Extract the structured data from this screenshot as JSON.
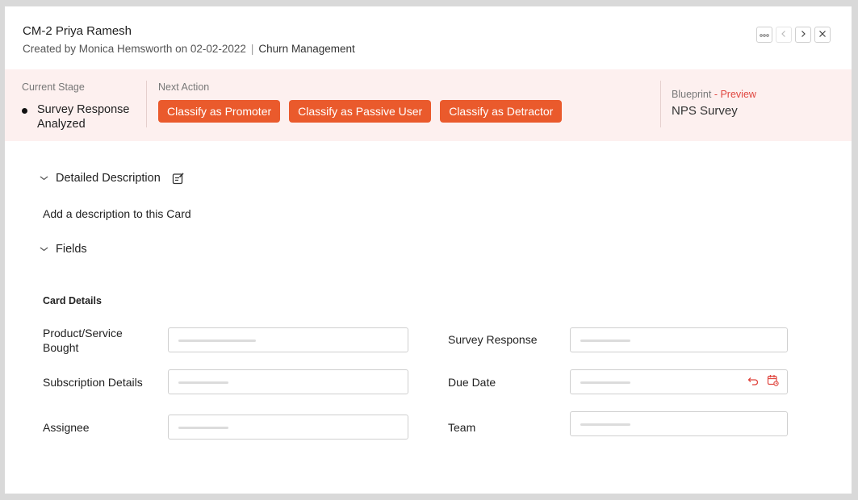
{
  "header": {
    "title": "CM-2 Priya Ramesh",
    "created_by": "Created by Monica Hemsworth on 02-02-2022",
    "separator": "|",
    "board": "Churn Management",
    "more_icon": "more-dots-icon",
    "prev_icon": "chevron-left-icon",
    "next_icon": "chevron-right-icon",
    "close_icon": "close-icon"
  },
  "stage": {
    "current_label": "Current Stage",
    "current_value": "Survey Response Analyzed",
    "next_label": "Next Action",
    "actions": [
      "Classify as Promoter",
      "Classify as Passive User",
      "Classify as Detractor"
    ],
    "blueprint_label": "Blueprint",
    "blueprint_preview": "- Preview",
    "blueprint_name": "NPS Survey"
  },
  "description": {
    "section_title": "Detailed Description",
    "placeholder": "Add a description to this Card",
    "edit_icon": "edit-icon"
  },
  "fields": {
    "section_title": "Fields",
    "card_details_title": "Card Details",
    "left": [
      {
        "label": "Product/Service Bought"
      },
      {
        "label": "Subscription Details"
      },
      {
        "label": "Assignee"
      }
    ],
    "right": [
      {
        "label": "Survey Response"
      },
      {
        "label": "Due Date"
      },
      {
        "label": "Team"
      }
    ],
    "due_date_icons": [
      "undo-icon",
      "calendar-icon"
    ]
  },
  "colors": {
    "accent": "#ea5a2c",
    "stage_bg": "#fdf0ef",
    "preview_link": "#e0463f",
    "page_bg": "#d9d9d9"
  }
}
